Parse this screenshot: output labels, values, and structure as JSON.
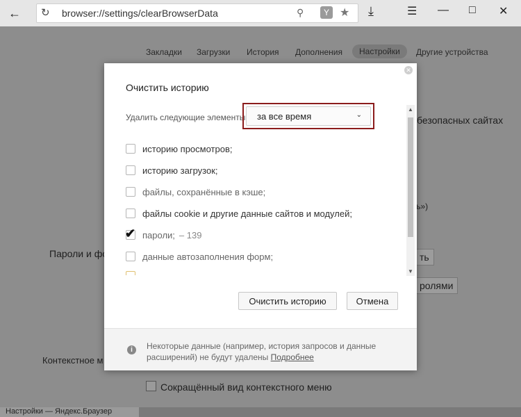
{
  "browser": {
    "url": "browser://settings/clearBrowserData",
    "yandex_button": "Y"
  },
  "settings_tabs": [
    "Закладки",
    "Загрузки",
    "История",
    "Дополнения",
    "Настройки",
    "Другие устройства"
  ],
  "active_tab": "Настройки",
  "background": {
    "safe_sites_text": "безопасных сайтах",
    "quote_fragment": "ъ»)",
    "passwords_forms_label": "Пароли и фо",
    "button_fragment": "ть",
    "passwords_button_fragment": "ролями",
    "context_menu_label": "Контекстное м",
    "compact_menu_label": "Сокращённый вид контекстного меню",
    "bottom_tab_label": "Настройки — Яндекс.Браузер"
  },
  "dialog": {
    "title": "Очистить историю",
    "delete_label": "Удалить следующие элементы:",
    "period": "за все время",
    "items": [
      {
        "label": "историю просмотров;",
        "checked": false,
        "dim": false
      },
      {
        "label": "историю загрузок;",
        "checked": false,
        "dim": false
      },
      {
        "label": "файлы, сохранённые в кэше;",
        "checked": false,
        "dim": false
      },
      {
        "label": "файлы cookie и другие данные сайтов и модулей;",
        "checked": false,
        "dim": false
      },
      {
        "label": "пароли;",
        "count": "– 139",
        "checked": true,
        "dim": true
      },
      {
        "label": "данные автозаполнения форм;",
        "checked": false,
        "dim": false
      }
    ],
    "clear_button": "Очистить историю",
    "cancel_button": "Отмена",
    "footer_note": "Некоторые данные (например, история запросов и данные расширений) не будут удалены",
    "footer_link": "Подробнее"
  }
}
